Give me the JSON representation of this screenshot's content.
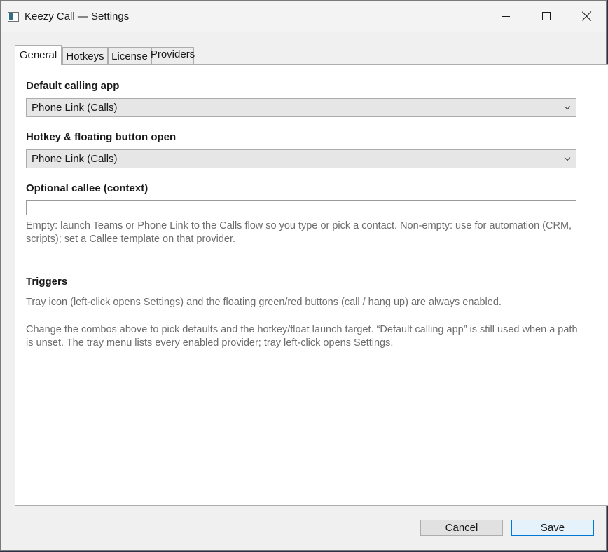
{
  "window": {
    "title": "Keezy Call — Settings"
  },
  "tabs": [
    {
      "label": "General",
      "active": true
    },
    {
      "label": "Hotkeys",
      "active": false
    },
    {
      "label": "License",
      "active": false
    },
    {
      "label": "Providers",
      "active": false
    }
  ],
  "general": {
    "default_app": {
      "label": "Default calling app",
      "value": "Phone Link (Calls)"
    },
    "hotkey_open": {
      "label": "Hotkey & floating button open",
      "value": "Phone Link (Calls)"
    },
    "callee": {
      "label": "Optional callee (context)",
      "value": "",
      "hint": "Empty: launch Teams or Phone Link to the Calls flow so you type or pick a contact. Non-empty: use for automation (CRM, scripts); set a Callee template on that provider."
    },
    "triggers": {
      "heading": "Triggers",
      "text1": "Tray icon (left-click opens Settings) and the floating green/red buttons (call / hang up) are always enabled.",
      "text2": "Change the combos above to pick defaults and the hotkey/float launch target. “Default calling app” is still used when a path is unset. The tray menu lists every enabled provider; tray left-click opens Settings."
    }
  },
  "buttons": {
    "cancel": "Cancel",
    "save": "Save"
  },
  "icons": {
    "app": "app-window-icon",
    "minimize": "minimize-icon",
    "maximize": "maximize-icon",
    "close": "close-icon",
    "dropdown": "chevron-down-icon"
  },
  "colors": {
    "accent": "#0078d7",
    "hint_text": "#6d6d6d"
  }
}
